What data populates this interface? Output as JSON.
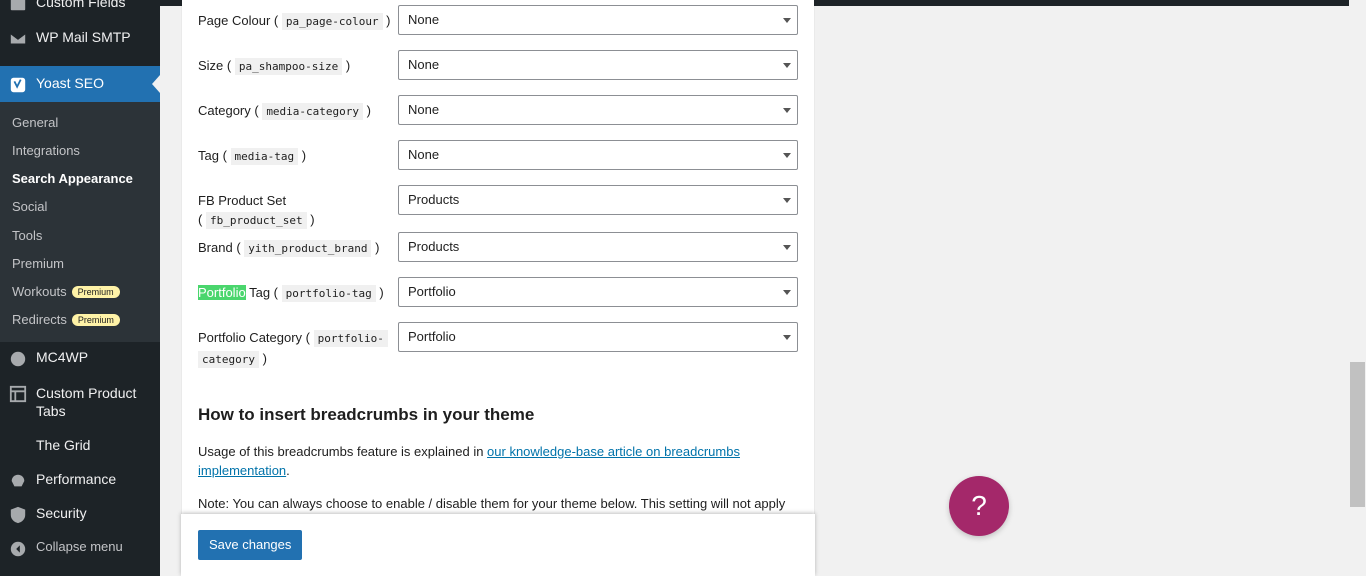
{
  "sidebar": {
    "items": [
      {
        "label": "Custom Fields",
        "icon": "custom-fields-icon"
      },
      {
        "label": "WP Mail SMTP",
        "icon": "mail-icon"
      },
      {
        "label": "Yoast SEO",
        "icon": "yoast-icon"
      },
      {
        "label": "MC4WP",
        "icon": "mc4wp-icon"
      },
      {
        "label": "Custom Product Tabs",
        "icon": "tabs-icon"
      },
      {
        "label": "The Grid",
        "icon": ""
      },
      {
        "label": "Performance",
        "icon": "performance-icon"
      },
      {
        "label": "Security",
        "icon": "shield-icon"
      },
      {
        "label": "Collapse menu",
        "icon": "collapse-icon"
      }
    ],
    "submenu": [
      {
        "label": "General"
      },
      {
        "label": "Integrations"
      },
      {
        "label": "Search Appearance"
      },
      {
        "label": "Social"
      },
      {
        "label": "Tools"
      },
      {
        "label": "Premium"
      },
      {
        "label": "Workouts",
        "badge": "Premium"
      },
      {
        "label": "Redirects",
        "badge": "Premium"
      }
    ]
  },
  "taxonomies": [
    {
      "label": "Page Colour",
      "slug": "pa_page-colour",
      "value": "None"
    },
    {
      "label": "Size",
      "slug": "pa_shampoo-size",
      "value": "None"
    },
    {
      "label": "Category",
      "slug": "media-category",
      "value": "None"
    },
    {
      "label": "Tag",
      "slug": "media-tag",
      "value": "None"
    },
    {
      "label": "FB Product Set",
      "slug": "fb_product_set",
      "value": "Products"
    },
    {
      "label": "Brand",
      "slug": "yith_product_brand",
      "value": "Products"
    },
    {
      "label_highlight": "Portfolio",
      "label": "Tag",
      "slug": "portfolio-tag",
      "value": "Portfolio"
    },
    {
      "label": "Portfolio Category",
      "slug_a": "portfolio-",
      "slug_b": "category",
      "value": "Portfolio"
    }
  ],
  "breadcrumbs_section": {
    "heading": "How to insert breadcrumbs in your theme",
    "usage_text": "Usage of this breadcrumbs feature is explained in ",
    "link_line1": "our knowledge-base article on breadcrumbs",
    "link_line2": "implementation",
    "usage_end": ".",
    "note": "Note: You can always choose to enable / disable them for your theme below. This setting will not apply"
  },
  "save_button": "Save changes",
  "help_button": "?",
  "colors": {
    "sidebar_bg": "#1d2327",
    "active_menu": "#2271b1",
    "button": "#2271b1",
    "help": "#a4286a",
    "highlight": "#4ad66d",
    "link": "#0073aa"
  }
}
